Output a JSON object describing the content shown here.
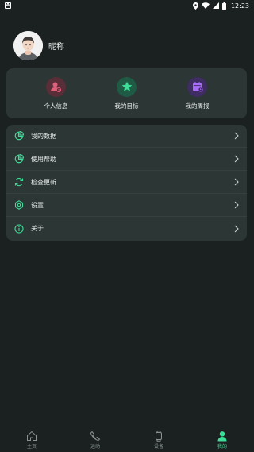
{
  "status_bar": {
    "time": "12:23",
    "icons": [
      "location-icon",
      "wifi-icon",
      "signal-icon",
      "battery-icon"
    ]
  },
  "profile": {
    "nickname": "昵称"
  },
  "quick_actions": [
    {
      "label": "个人信息",
      "icon": "person-icon",
      "color": "#d9556a"
    },
    {
      "label": "我的目标",
      "icon": "star-icon",
      "color": "#3ddc97"
    },
    {
      "label": "我的周报",
      "icon": "calendar-icon",
      "color": "#a76cf5"
    }
  ],
  "menu": [
    {
      "label": "我的数据",
      "icon": "pie-chart-icon"
    },
    {
      "label": "使用帮助",
      "icon": "help-icon"
    },
    {
      "label": "检查更新",
      "icon": "refresh-icon"
    },
    {
      "label": "设置",
      "icon": "settings-icon"
    },
    {
      "label": "关于",
      "icon": "info-icon"
    }
  ],
  "bottom_nav": [
    {
      "label": "主页",
      "icon": "home-icon",
      "active": false
    },
    {
      "label": "运动",
      "icon": "sport-icon",
      "active": false
    },
    {
      "label": "设备",
      "icon": "watch-icon",
      "active": false
    },
    {
      "label": "我的",
      "icon": "profile-icon",
      "active": true
    }
  ],
  "colors": {
    "accent": "#3ddc97",
    "background": "#1a2120",
    "card": "#2c3634"
  }
}
